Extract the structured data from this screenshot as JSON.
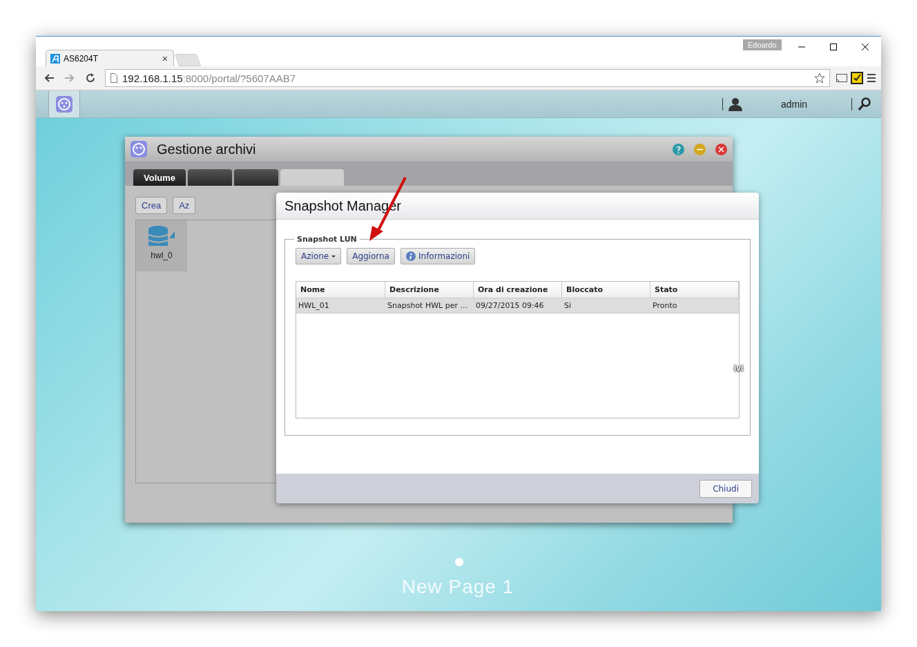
{
  "browser": {
    "tab": {
      "title": "AS6204T",
      "close": "×"
    },
    "profile": "Edoardo",
    "url": {
      "host": "192.168.1.15",
      "rest": ":8000/portal/?5607AAB7"
    }
  },
  "topbar": {
    "user": "admin"
  },
  "desktop": {
    "icon_label": "ivi",
    "page_dot": {
      "selected": true
    },
    "page_name": "New Page 1"
  },
  "app_window": {
    "title": "Gestione archivi",
    "tabs": [
      {
        "label": "Volume",
        "selected": true,
        "kind": "dark"
      },
      {
        "selected": false,
        "kind": "dark"
      },
      {
        "selected": false,
        "kind": "dark"
      },
      {
        "selected": false,
        "kind": "light"
      }
    ],
    "toolbar": [
      "Crea",
      "Az"
    ],
    "volume": {
      "label": "hwl_0"
    }
  },
  "dialog": {
    "title": "Snapshot Manager",
    "group": "Snapshot LUN",
    "buttons": [
      {
        "label": "Azione",
        "kind": "menu"
      },
      {
        "label": "Aggiorna",
        "kind": "plain"
      },
      {
        "label": "Informazioni",
        "kind": "info"
      }
    ],
    "table": {
      "columns": [
        "Nome",
        "Descrizione",
        "Ora di creazione",
        "Bloccato",
        "Stato"
      ],
      "rows": [
        {
          "cells": [
            "HWL_01",
            "Snapshot HWL per ...",
            "09/27/2015 09:46",
            "Si",
            "Pronto"
          ],
          "selected": true
        }
      ]
    },
    "footer_button": "Chiudi"
  }
}
